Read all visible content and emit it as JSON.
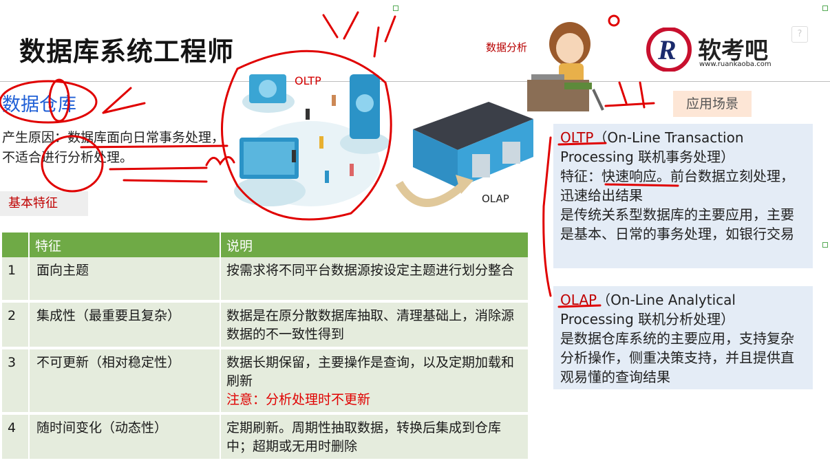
{
  "title": "数据库系统工程师",
  "subtitle": "数据仓库",
  "reason": "产生原因：数据库面向日常事务处理，不适合进行分析处理。",
  "basic_tag": "基本特征",
  "table": {
    "headers": [
      "",
      "特征",
      "说明"
    ],
    "rows": [
      {
        "num": "1",
        "feature": "面向主题",
        "desc": "按需求将不同平台数据源按设定主题进行划分整合",
        "note": ""
      },
      {
        "num": "2",
        "feature": "集成性（最重要且复杂）",
        "desc": "数据是在原分散数据库抽取、清理基础上，消除源数据的不一致性得到",
        "note": ""
      },
      {
        "num": "3",
        "feature": "不可更新（相对稳定性）",
        "desc": "数据长期保留，主要操作是查询，以及定期加载和刷新",
        "note": "注意：分析处理时不更新"
      },
      {
        "num": "4",
        "feature": "随时间变化（动态性）",
        "desc": "定期刷新。周期性抽取数据，转换后集成到仓库中；超期或无用时删除",
        "note": ""
      }
    ]
  },
  "diagram": {
    "oltp_label": "OLTP",
    "olap_label": "OLAP",
    "speaker": "数据分析"
  },
  "logo": {
    "brand": "软考吧",
    "url": "www.ruankaoba.com"
  },
  "scene_tag": "应用场景",
  "oltp_box": {
    "heading": "OLTP",
    "rest": "（On-Line Transaction Processing 联机事务处理）",
    "body": "特征：快速响应。前台数据立刻处理，迅速给出结果\n是传统关系型数据库的主要应用，主要是基本、日常的事务处理，如银行交易"
  },
  "olap_box": {
    "heading": "OLAP",
    "rest": "（On-Line Analytical Processing 联机分析处理）",
    "body": "是数据仓库系统的主要应用，支持复杂分析操作，侧重决策支持，并且提供直观易懂的查询结果"
  },
  "help_icon": "?",
  "colors": {
    "header_green": "#6faa46",
    "row_bg": "#e5ecdd",
    "box_blue": "#e4ecf6",
    "accent_red": "#c00000",
    "title_blue": "#1f5fd6"
  }
}
